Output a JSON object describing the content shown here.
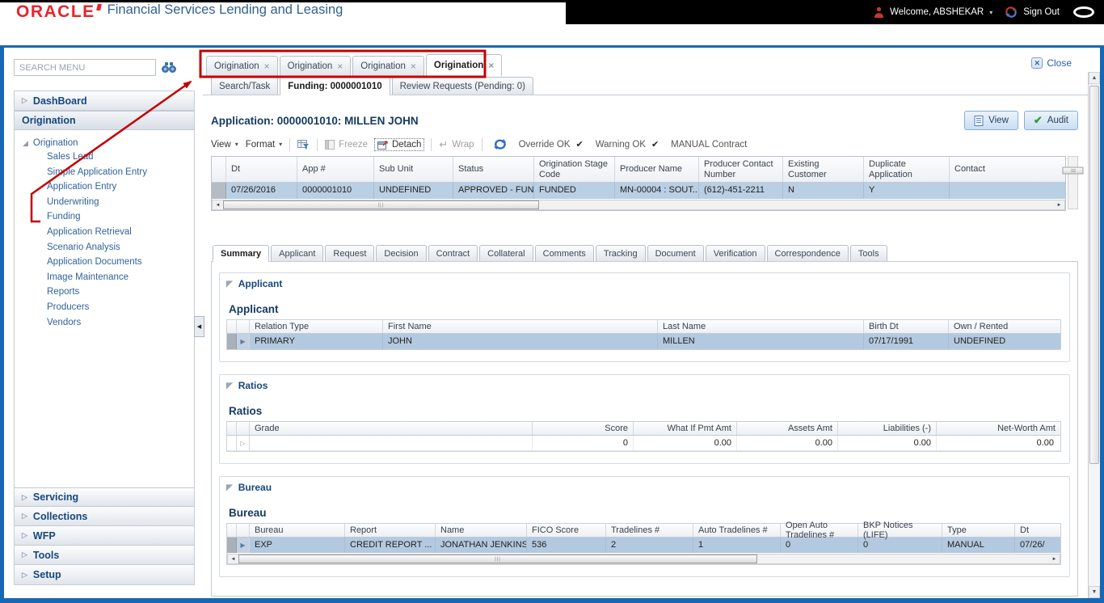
{
  "header": {
    "logo": "ORACLE",
    "subtitle": "Financial Services Lending and Leasing",
    "welcome_label": "Welcome, ABSHEKAR",
    "sign_out_label": "Sign Out"
  },
  "sidebar": {
    "search_placeholder": "SEARCH MENU",
    "dashboard_label": "DashBoard",
    "origination_header": "Origination",
    "tree_root": "Origination",
    "tree_items": [
      "Sales Lead",
      "Simple Application Entry",
      "Application Entry",
      "Underwriting",
      "Funding",
      "Application Retrieval",
      "Scenario Analysis",
      "Application Documents",
      "Image Maintenance",
      "Reports",
      "Producers",
      "Vendors"
    ],
    "bottom_sections": [
      "Servicing",
      "Collections",
      "WFP",
      "Tools",
      "Setup"
    ]
  },
  "window_tabs": [
    "Origination",
    "Origination",
    "Origination",
    "Origination"
  ],
  "close_label": "Close",
  "sub_tabs": [
    "Search/Task",
    "Funding: 0000001010",
    "Review Requests (Pending: 0)"
  ],
  "app": {
    "title": "Application: 0000001010: MILLEN JOHN",
    "buttons": {
      "view": "View",
      "audit": "Audit"
    },
    "toolbar": {
      "view": "View",
      "format": "Format",
      "freeze": "Freeze",
      "detach": "Detach",
      "wrap": "Wrap",
      "override": "Override OK",
      "warning": "Warning OK",
      "manual": "MANUAL Contract"
    },
    "grid": {
      "columns": [
        "Dt",
        "App #",
        "Sub Unit",
        "Status",
        "Origination Stage Code",
        "Producer Name",
        "Producer Contact Number",
        "Existing Customer",
        "Duplicate Application",
        "Contact"
      ],
      "row": [
        "07/26/2016",
        "0000001010",
        "UNDEFINED",
        "APPROVED - FUND...",
        "FUNDED",
        "MN-00004 : SOUT...",
        "(612)-451-2211",
        "N",
        "Y",
        ""
      ]
    }
  },
  "summary_tabs": [
    "Summary",
    "Applicant",
    "Request",
    "Decision",
    "Contract",
    "Collateral",
    "Comments",
    "Tracking",
    "Document",
    "Verification",
    "Correspondence",
    "Tools"
  ],
  "applicant_section": {
    "header": "Applicant",
    "title": "Applicant",
    "columns": [
      "Relation Type",
      "First Name",
      "Last Name",
      "Birth Dt",
      "Own / Rented"
    ],
    "row": [
      "PRIMARY",
      "JOHN",
      "MILLEN",
      "07/17/1991",
      "UNDEFINED"
    ]
  },
  "ratios_section": {
    "header": "Ratios",
    "title": "Ratios",
    "columns": [
      "Grade",
      "Score",
      "What If Pmt Amt",
      "Assets Amt",
      "Liabilities (-)",
      "Net-Worth Amt"
    ],
    "row": [
      "",
      "0",
      "0.00",
      "0.00",
      "0.00",
      "0.00"
    ]
  },
  "bureau_section": {
    "header": "Bureau",
    "title": "Bureau",
    "columns": [
      "Bureau",
      "Report",
      "Name",
      "FICO Score",
      "Tradelines #",
      "Auto Tradelines #",
      "Open Auto Tradelines #",
      "BKP Notices (LIFE)",
      "Type",
      "Dt"
    ],
    "row": [
      "EXP",
      "CREDIT REPORT ...",
      "JONATHAN JENKINS",
      "536",
      "2",
      "1",
      "0",
      "0",
      "MANUAL",
      "07/26/"
    ]
  },
  "glyphs": {
    "caret_down": "▾",
    "close_tab": "×",
    "close_x": "✕",
    "check": "✔",
    "chevron_right": "▷",
    "tree_expanded": "◢",
    "section_collapse": "◤",
    "row_arrow": "▶",
    "row_arrow_open": "▷",
    "wrap": "↵",
    "grip": "|||",
    "scroll_left": "◄",
    "scroll_right": "►",
    "scroll_up": "▲",
    "scroll_down": "▼",
    "collapse_left": "◀"
  },
  "colors": {
    "annotation_red": "#c40000",
    "frame_blue": "#1768b4",
    "oracle_red": "#e8242c",
    "selected_row": "#b9cfe4",
    "link_blue": "#2f6da8",
    "header_text_blue": "#15477e"
  }
}
